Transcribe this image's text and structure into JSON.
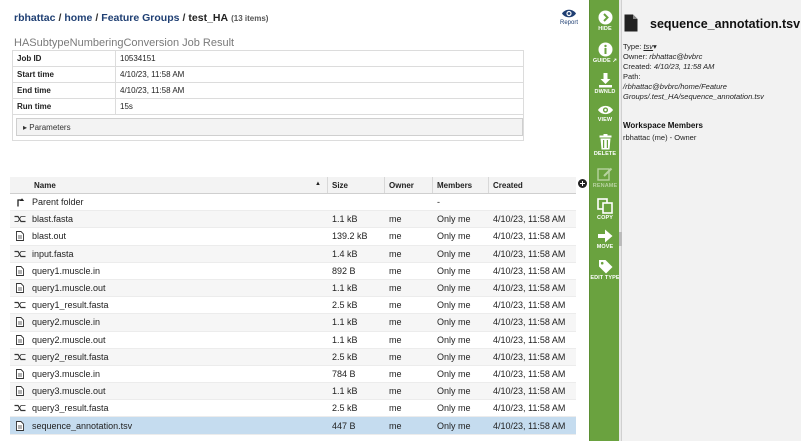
{
  "breadcrumb": {
    "items": [
      "rbhattac",
      "home",
      "Feature Groups"
    ],
    "current": "test_HA",
    "count": "(13 items)"
  },
  "report": {
    "label": "Report"
  },
  "job": {
    "title": "HASubtypeNumberingConversion Job Result",
    "rows": [
      {
        "key": "Job ID",
        "value": "10534151"
      },
      {
        "key": "Start time",
        "value": "4/10/23, 11:58 AM"
      },
      {
        "key": "End time",
        "value": "4/10/23, 11:58 AM"
      },
      {
        "key": "Run time",
        "value": "15s"
      }
    ],
    "parameters_label": "Parameters"
  },
  "grid": {
    "headers": {
      "name": "Name",
      "size": "Size",
      "owner": "Owner",
      "members": "Members",
      "created": "Created"
    },
    "rows": [
      {
        "icon": "parent-folder",
        "name": "Parent folder",
        "size": "",
        "owner": "",
        "members": "-",
        "created": ""
      },
      {
        "icon": "fasta",
        "name": "blast.fasta",
        "size": "1.1 kB",
        "owner": "me",
        "members": "Only me",
        "created": "4/10/23, 11:58 AM"
      },
      {
        "icon": "file",
        "name": "blast.out",
        "size": "139.2 kB",
        "owner": "me",
        "members": "Only me",
        "created": "4/10/23, 11:58 AM"
      },
      {
        "icon": "fasta",
        "name": "input.fasta",
        "size": "1.4 kB",
        "owner": "me",
        "members": "Only me",
        "created": "4/10/23, 11:58 AM"
      },
      {
        "icon": "file",
        "name": "query1.muscle.in",
        "size": "892 B",
        "owner": "me",
        "members": "Only me",
        "created": "4/10/23, 11:58 AM"
      },
      {
        "icon": "file",
        "name": "query1.muscle.out",
        "size": "1.1 kB",
        "owner": "me",
        "members": "Only me",
        "created": "4/10/23, 11:58 AM"
      },
      {
        "icon": "fasta",
        "name": "query1_result.fasta",
        "size": "2.5 kB",
        "owner": "me",
        "members": "Only me",
        "created": "4/10/23, 11:58 AM"
      },
      {
        "icon": "file",
        "name": "query2.muscle.in",
        "size": "1.1 kB",
        "owner": "me",
        "members": "Only me",
        "created": "4/10/23, 11:58 AM"
      },
      {
        "icon": "file",
        "name": "query2.muscle.out",
        "size": "1.1 kB",
        "owner": "me",
        "members": "Only me",
        "created": "4/10/23, 11:58 AM"
      },
      {
        "icon": "fasta",
        "name": "query2_result.fasta",
        "size": "2.5 kB",
        "owner": "me",
        "members": "Only me",
        "created": "4/10/23, 11:58 AM"
      },
      {
        "icon": "file",
        "name": "query3.muscle.in",
        "size": "784 B",
        "owner": "me",
        "members": "Only me",
        "created": "4/10/23, 11:58 AM"
      },
      {
        "icon": "file",
        "name": "query3.muscle.out",
        "size": "1.1 kB",
        "owner": "me",
        "members": "Only me",
        "created": "4/10/23, 11:58 AM"
      },
      {
        "icon": "fasta",
        "name": "query3_result.fasta",
        "size": "2.5 kB",
        "owner": "me",
        "members": "Only me",
        "created": "4/10/23, 11:58 AM"
      },
      {
        "icon": "file",
        "name": "sequence_annotation.tsv",
        "size": "447 B",
        "owner": "me",
        "members": "Only me",
        "created": "4/10/23, 11:58 AM",
        "selected": true
      }
    ]
  },
  "actions": {
    "hide": "HIDE",
    "guide": "GUIDE",
    "download": "DWNLD",
    "view": "VIEW",
    "delete": "DELETE",
    "rename": "RENAME",
    "copy": "COPY",
    "move": "MOVE",
    "edit_type": "EDIT TYPE"
  },
  "details": {
    "title": "sequence_annotation.tsv",
    "type_label": "Type:",
    "type_value": "tsv",
    "owner_label": "Owner:",
    "owner_value": "rbhattac@bvbrc",
    "created_label": "Created:",
    "created_value": "4/10/23, 11:58 AM",
    "path_label": "Path:",
    "path_value": "/rbhattac@bvbrc/home/Feature Groups/.test_HA/sequence_annotation.tsv",
    "members_title": "Workspace Members",
    "members": [
      "rbhattac (me) - Owner"
    ]
  },
  "colors": {
    "accent_green": "#6aa23f",
    "link_blue": "#1f3f73",
    "selected_row": "#c5dcef"
  }
}
